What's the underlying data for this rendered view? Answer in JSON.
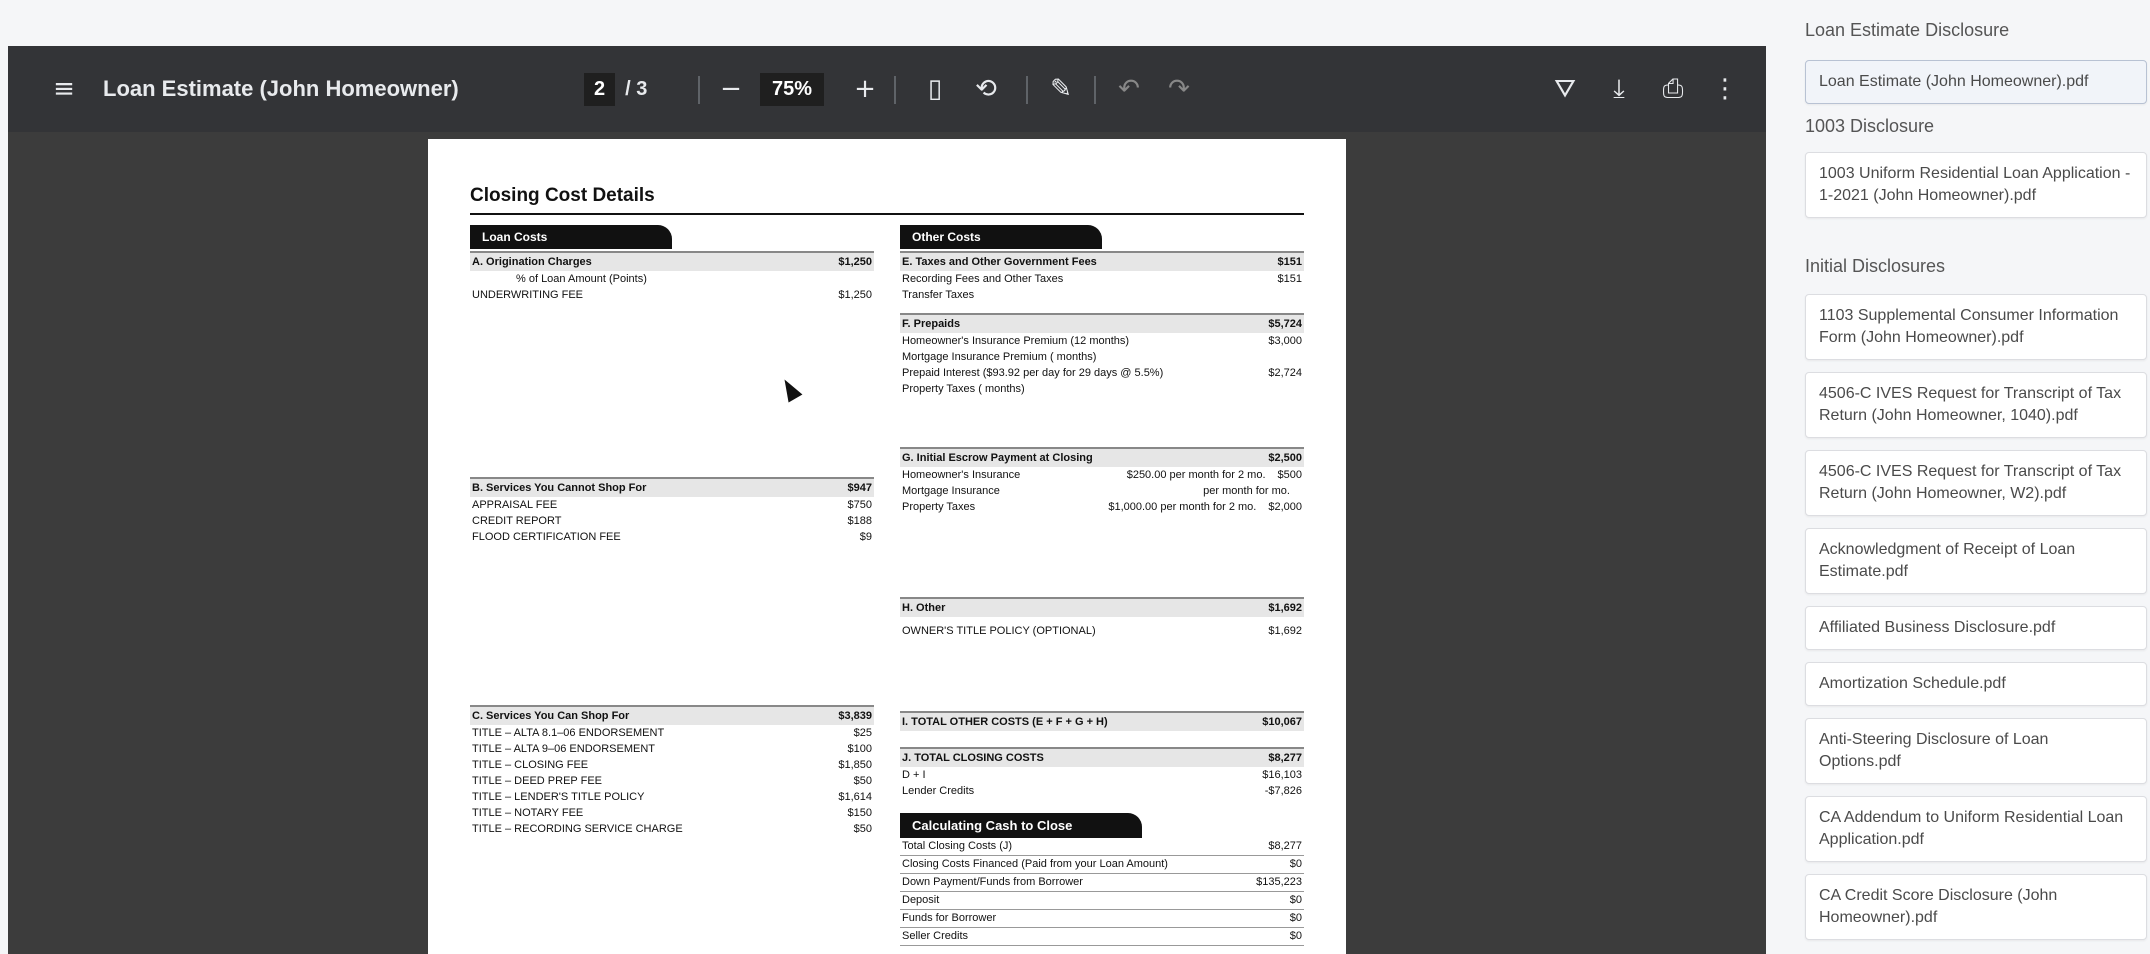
{
  "viewer": {
    "title": "Loan Estimate (John Homeowner)",
    "page_current": "2",
    "page_total": "/  3",
    "zoom": "75%",
    "icons": {
      "menu": "≡",
      "zoom_out": "−",
      "zoom_in": "+",
      "fit": "▯",
      "rotate": "⟲",
      "annotate": "✎",
      "undo": "↶",
      "redo": "↷",
      "drive": "⛛",
      "download": "⤓",
      "print": "⎙",
      "more": "⋮"
    }
  },
  "document": {
    "title": "Closing Cost Details",
    "loan_costs_tab": "Loan Costs",
    "other_costs_tab": "Other Costs",
    "sections": {
      "A": {
        "label": "A. Origination Charges",
        "amount": "$1,250",
        "rows": [
          {
            "label": "% of Loan Amount (Points)",
            "amount": ""
          },
          {
            "label": "UNDERWRITING FEE",
            "amount": "$1,250"
          }
        ]
      },
      "B": {
        "label": "B. Services You Cannot Shop For",
        "amount": "$947",
        "rows": [
          {
            "label": "APPRAISAL FEE",
            "amount": "$750"
          },
          {
            "label": "CREDIT REPORT",
            "amount": "$188"
          },
          {
            "label": "FLOOD CERTIFICATION FEE",
            "amount": "$9"
          }
        ]
      },
      "C": {
        "label": "C. Services You Can Shop For",
        "amount": "$3,839",
        "rows": [
          {
            "label": "TITLE – ALTA 8.1–06 ENDORSEMENT",
            "amount": "$25"
          },
          {
            "label": "TITLE – ALTA 9–06 ENDORSEMENT",
            "amount": "$100"
          },
          {
            "label": "TITLE – CLOSING FEE",
            "amount": "$1,850"
          },
          {
            "label": "TITLE – DEED PREP FEE",
            "amount": "$50"
          },
          {
            "label": "TITLE – LENDER'S TITLE POLICY",
            "amount": "$1,614"
          },
          {
            "label": "TITLE – NOTARY FEE",
            "amount": "$150"
          },
          {
            "label": "TITLE – RECORDING SERVICE CHARGE",
            "amount": "$50"
          }
        ]
      },
      "E": {
        "label": "E. Taxes and Other Government Fees",
        "amount": "$151",
        "rows": [
          {
            "label": "Recording Fees and Other Taxes",
            "amount": "$151"
          },
          {
            "label": "Transfer Taxes",
            "amount": ""
          }
        ]
      },
      "F": {
        "label": "F. Prepaids",
        "amount": "$5,724",
        "rows": [
          {
            "label": "Homeowner's Insurance Premium (12 months)",
            "amount": "$3,000"
          },
          {
            "label": "Mortgage Insurance Premium (        months)",
            "amount": ""
          },
          {
            "label": "Prepaid Interest ($93.92 per day for 29 days @ 5.5%)",
            "amount": "$2,724"
          },
          {
            "label": "Property Taxes (          months)",
            "amount": ""
          }
        ]
      },
      "G": {
        "label": "G. Initial Escrow Payment at Closing",
        "amount": "$2,500",
        "rows": [
          {
            "label": "Homeowner's Insurance",
            "mid": "$250.00 per month for  2  mo.",
            "amount": "$500"
          },
          {
            "label": "Mortgage Insurance",
            "mid": "per month for      mo.",
            "amount": ""
          },
          {
            "label": "Property Taxes",
            "mid": "$1,000.00 per month for  2  mo.",
            "amount": "$2,000"
          }
        ]
      },
      "H": {
        "label": "H. Other",
        "amount": "$1,692",
        "rows": [
          {
            "label": "OWNER'S TITLE POLICY (OPTIONAL)",
            "amount": "$1,692"
          }
        ]
      },
      "I": {
        "label": "I. TOTAL OTHER COSTS (E + F + G + H)",
        "amount": "$10,067"
      },
      "J": {
        "label": "J. TOTAL CLOSING COSTS",
        "amount": "$8,277",
        "rows": [
          {
            "label": "D + I",
            "amount": "$16,103"
          },
          {
            "label": "Lender Credits",
            "amount": "-$7,826"
          }
        ]
      }
    },
    "calc": {
      "tab": "Calculating Cash to Close",
      "rows": [
        {
          "label": "Total Closing Costs (J)",
          "amount": "$8,277"
        },
        {
          "label": "Closing Costs Financed (Paid from your Loan Amount)",
          "amount": "$0"
        },
        {
          "label": "Down Payment/Funds from Borrower",
          "amount": "$135,223"
        },
        {
          "label": "Deposit",
          "amount": "$0"
        },
        {
          "label": "Funds for Borrower",
          "amount": "$0"
        },
        {
          "label": "Seller Credits",
          "amount": "$0"
        }
      ]
    }
  },
  "sidebar": {
    "groups": [
      {
        "heading": "Loan Estimate Disclosure",
        "items": [
          "Loan Estimate (John Homeowner).pdf"
        ]
      },
      {
        "heading": "1003 Disclosure",
        "items": [
          "1003 Uniform Residential Loan Application - 1-2021 (John Homeowner).pdf"
        ]
      },
      {
        "heading": "Initial Disclosures",
        "items": [
          "1103 Supplemental Consumer Information Form (John Homeowner).pdf",
          "4506-C IVES Request for Transcript of Tax Return (John Homeowner, 1040).pdf",
          "4506-C IVES Request for Transcript of Tax Return (John Homeowner, W2).pdf",
          "Acknowledgment of Receipt of Loan Estimate.pdf",
          "Affiliated Business Disclosure.pdf",
          "Amortization Schedule.pdf",
          "Anti-Steering Disclosure of Loan Options.pdf",
          "CA Addendum to Uniform Residential Loan Application.pdf",
          "CA Credit Score Disclosure (John Homeowner).pdf"
        ]
      }
    ]
  }
}
